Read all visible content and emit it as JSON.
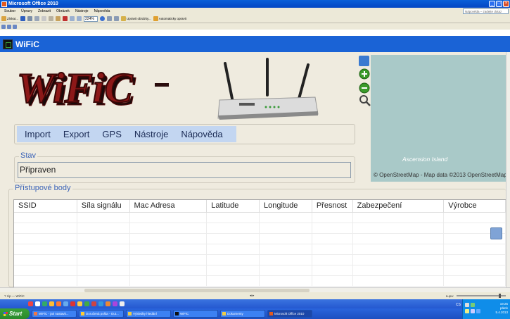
{
  "window": {
    "title": "Microsoft Office 2010"
  },
  "menubar": {
    "items": [
      "Soubor",
      "Úpravy",
      "Zobrazit",
      "Obrázek",
      "Nástroje",
      "Nápověda"
    ],
    "help_placeholder": "Nápověda – zadejte dotaz"
  },
  "toolbar": {
    "scan_label": "Získat...",
    "zoom_value": "224%",
    "edit_label": "Upravit obrázky...",
    "autocorrect_label": "Automaticky opravit"
  },
  "app": {
    "title": "WiFiC",
    "logo_text": "WiFiC",
    "menu": [
      "Import",
      "Export",
      "GPS",
      "Nástroje",
      "Nápověda"
    ],
    "status_legend": "Stav",
    "status_value": "Připraven",
    "ap_legend": "Přístupové body",
    "table_columns": [
      "SSID",
      "Síla signálu",
      "Mac Adresa",
      "Latitude",
      "Longitude",
      "Přesnost",
      "Zabezpečení",
      "Výrobce"
    ],
    "table_rows": [
      [],
      [],
      [],
      [],
      [],
      [],
      []
    ]
  },
  "map": {
    "place_label": "Ascension Island",
    "attribution": "© OpenStreetMap - Map data ©2013 OpenStreetMap"
  },
  "office_status": {
    "left": "? zip — WiFiC",
    "pager": "◂ ▸",
    "zoom_label": "Lupa:"
  },
  "taskbar": {
    "start_label": "Start",
    "tasks": [
      "WiFiC - jak nastavit...",
      "Doručená pošta - Out...",
      "Výsledky hledání",
      "WiFiC",
      "Dokumenty",
      "Microsoft Office 2010"
    ],
    "language": "CS",
    "clock_time": "19:25",
    "clock_day": "pátek",
    "clock_date": "5.4.2013"
  }
}
